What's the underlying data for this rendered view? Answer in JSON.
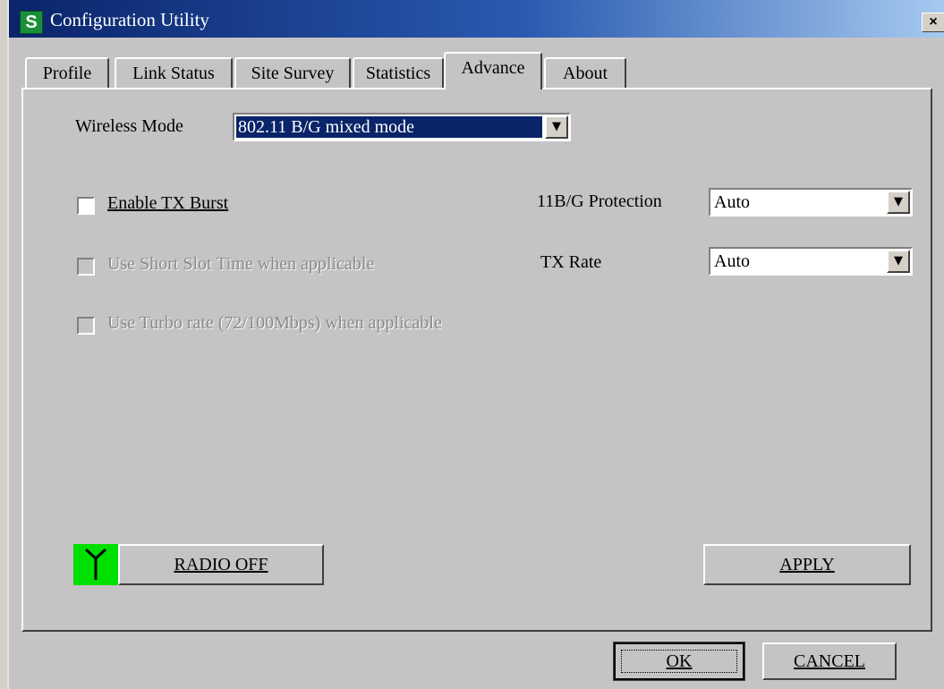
{
  "window": {
    "title": "Configuration Utility",
    "app_icon_letter": "S",
    "close_glyph": "×"
  },
  "tabs": [
    {
      "label": "Profile"
    },
    {
      "label": "Link Status"
    },
    {
      "label": "Site Survey"
    },
    {
      "label": "Statistics"
    },
    {
      "label": "Advance",
      "active": true
    },
    {
      "label": "About"
    }
  ],
  "advance": {
    "wireless_mode_label": "Wireless Mode",
    "wireless_mode_value": "802.11 B/G mixed mode",
    "enable_tx_burst_label": "Enable TX Burst",
    "enable_tx_burst_checked": false,
    "short_slot_label": "Use Short Slot Time when applicable",
    "short_slot_checked": false,
    "turbo_rate_label": "Use Turbo rate (72/100Mbps) when applicable",
    "turbo_rate_checked": false,
    "protection_label": "11B/G Protection",
    "protection_value": "Auto",
    "tx_rate_label": "TX Rate",
    "tx_rate_value": "Auto",
    "radio_off_button": "RADIO OFF",
    "apply_button": "APPLY"
  },
  "footer": {
    "ok_button": "OK",
    "cancel_button": "CANCEL"
  },
  "icons": {
    "dropdown_arrow": "▼",
    "antenna": "antenna-icon"
  },
  "colors": {
    "title_bar": "#0a246a",
    "selection": "#0a246a",
    "radio_indicator": "#00e000",
    "face": "#c6c3c6"
  }
}
